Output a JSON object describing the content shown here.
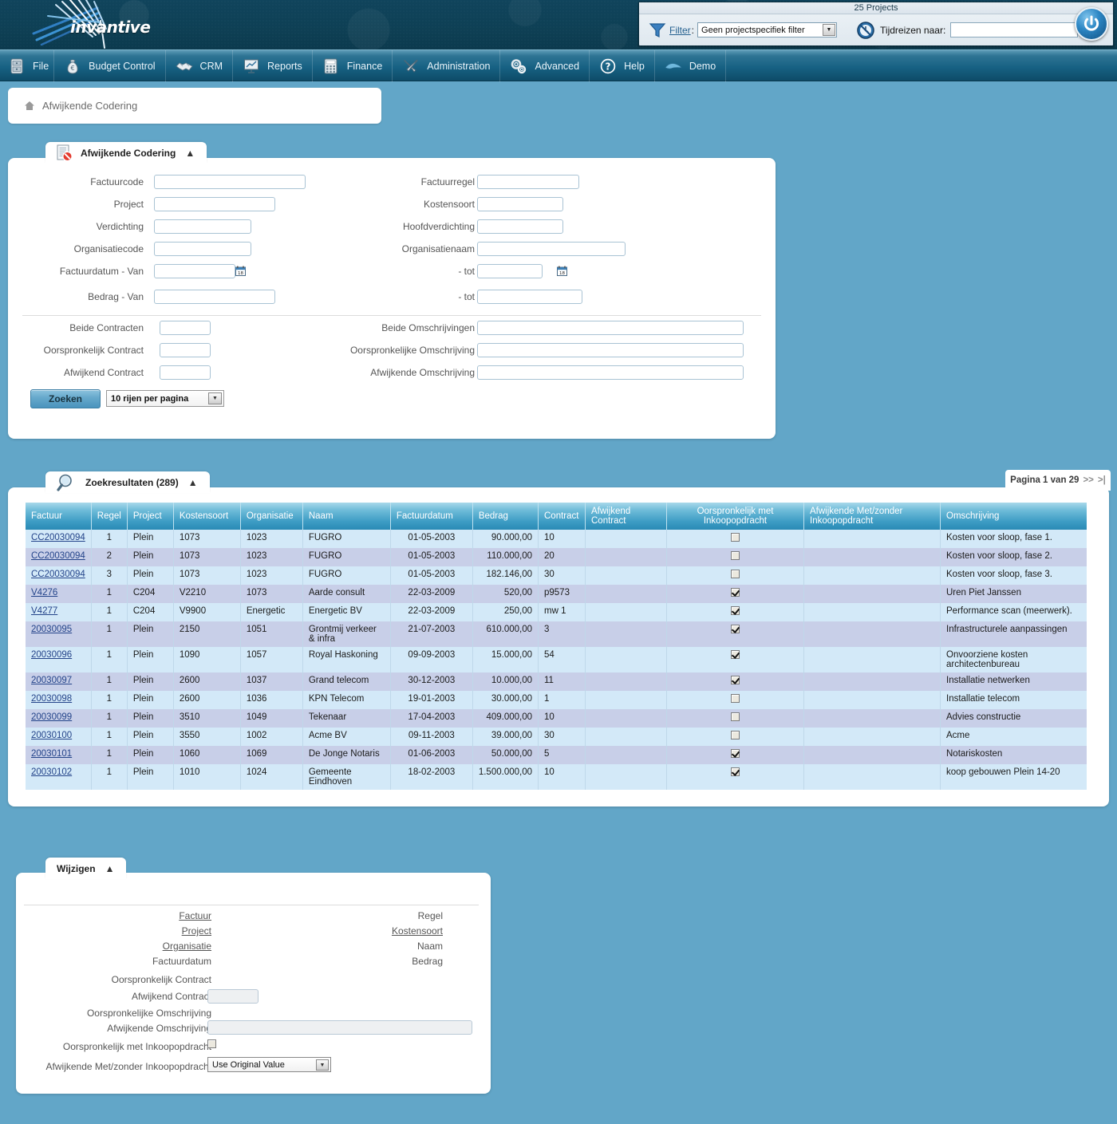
{
  "banner": {
    "logo_text": "invantive",
    "projects_count_label": "25 Projects",
    "filter_label": "Filter",
    "filter_colon": ":",
    "filter_value": "Geen projectspecifiek filter",
    "timetravel_label": "Tijdreizen naar:",
    "timetravel_value": ""
  },
  "menu": {
    "items": [
      {
        "label": "File",
        "icon": "file-cabinet-icon"
      },
      {
        "label": "Budget Control",
        "icon": "money-bag-icon"
      },
      {
        "label": "CRM",
        "icon": "handshake-icon"
      },
      {
        "label": "Reports",
        "icon": "presentation-chart-icon"
      },
      {
        "label": "Finance",
        "icon": "calculator-icon"
      },
      {
        "label": "Administration",
        "icon": "tools-icon"
      },
      {
        "label": "Advanced",
        "icon": "gears-icon"
      },
      {
        "label": "Help",
        "icon": "question-circle-icon"
      },
      {
        "label": "Demo",
        "icon": "bird-logo-icon"
      }
    ]
  },
  "breadcrumb": {
    "home_icon": "home-icon",
    "text": "Afwijkende Codering"
  },
  "search_panel": {
    "tab_label": "Afwijkende Codering",
    "tab_icon": "document-blocked-icon",
    "collapse_icon": "chevron-up-icon",
    "fields_left": [
      {
        "label": "Factuurcode",
        "value": ""
      },
      {
        "label": "Project",
        "value": ""
      },
      {
        "label": "Verdichting",
        "value": ""
      },
      {
        "label": "Organisatiecode",
        "value": ""
      },
      {
        "label": "Factuurdatum - Van",
        "value": ""
      },
      {
        "label": "Bedrag - Van",
        "value": ""
      }
    ],
    "fields_right": [
      {
        "label": "Factuurregel",
        "value": ""
      },
      {
        "label": "Kostensoort",
        "value": ""
      },
      {
        "label": "Hoofdverdichting",
        "value": ""
      },
      {
        "label": "Organisatienaam",
        "value": ""
      },
      {
        "label": "- tot",
        "value": ""
      },
      {
        "label": "- tot",
        "value": ""
      }
    ],
    "fields_left2": [
      {
        "label": "Beide Contracten",
        "value": ""
      },
      {
        "label": "Oorspronkelijk Contract",
        "value": ""
      },
      {
        "label": "Afwijkend Contract",
        "value": ""
      }
    ],
    "fields_right2": [
      {
        "label": "Beide Omschrijvingen",
        "value": ""
      },
      {
        "label": "Oorspronkelijke Omschrijving",
        "value": ""
      },
      {
        "label": "Afwijkende Omschrijving",
        "value": ""
      }
    ],
    "search_button": "Zoeken",
    "rows_per_page": "10 rijen per pagina"
  },
  "results": {
    "tab_label": "Zoekresultaten (289)",
    "tab_icon": "magnifier-icon",
    "collapse_icon": "chevron-up-icon",
    "pager_text": "Pagina 1 van 29",
    "pager_next": ">>",
    "pager_last": ">|",
    "columns": [
      "Factuur",
      "Regel",
      "Project",
      "Kostensoort",
      "Organisatie",
      "Naam",
      "Factuurdatum",
      "Bedrag",
      "Contract",
      "Afwijkend Contract",
      "Oorspronkelijk met Inkoopopdracht",
      "Afwijkende Met/zonder Inkoopopdracht",
      "Omschrijving"
    ],
    "rows": [
      {
        "factuur": "CC20030094",
        "regel": "1",
        "project": "Plein",
        "kostensoort": "1073",
        "organisatie": "1023",
        "naam": "FUGRO",
        "factuurdatum": "01-05-2003",
        "bedrag": "90.000,00",
        "contract": "10",
        "afwijkend_contract": "",
        "oorspronkelijk_inkoop": false,
        "afwijkende_inkoop": "",
        "omschrijving": "Kosten voor sloop, fase 1."
      },
      {
        "factuur": "CC20030094",
        "regel": "2",
        "project": "Plein",
        "kostensoort": "1073",
        "organisatie": "1023",
        "naam": "FUGRO",
        "factuurdatum": "01-05-2003",
        "bedrag": "110.000,00",
        "contract": "20",
        "afwijkend_contract": "",
        "oorspronkelijk_inkoop": false,
        "afwijkende_inkoop": "",
        "omschrijving": "Kosten voor sloop, fase 2."
      },
      {
        "factuur": "CC20030094",
        "regel": "3",
        "project": "Plein",
        "kostensoort": "1073",
        "organisatie": "1023",
        "naam": "FUGRO",
        "factuurdatum": "01-05-2003",
        "bedrag": "182.146,00",
        "contract": "30",
        "afwijkend_contract": "",
        "oorspronkelijk_inkoop": false,
        "afwijkende_inkoop": "",
        "omschrijving": "Kosten voor sloop, fase 3."
      },
      {
        "factuur": "V4276",
        "regel": "1",
        "project": "C204",
        "kostensoort": "V2210",
        "organisatie": "1073",
        "naam": "Aarde consult",
        "factuurdatum": "22-03-2009",
        "bedrag": "520,00",
        "contract": "p9573",
        "afwijkend_contract": "",
        "oorspronkelijk_inkoop": true,
        "afwijkende_inkoop": "",
        "omschrijving": "Uren Piet Janssen"
      },
      {
        "factuur": "V4277",
        "regel": "1",
        "project": "C204",
        "kostensoort": "V9900",
        "organisatie": "Energetic",
        "naam": "Energetic BV",
        "factuurdatum": "22-03-2009",
        "bedrag": "250,00",
        "contract": "mw 1",
        "afwijkend_contract": "",
        "oorspronkelijk_inkoop": true,
        "afwijkende_inkoop": "",
        "omschrijving": "Performance scan (meerwerk)."
      },
      {
        "factuur": "20030095",
        "regel": "1",
        "project": "Plein",
        "kostensoort": "2150",
        "organisatie": "1051",
        "naam": "Grontmij verkeer & infra",
        "factuurdatum": "21-07-2003",
        "bedrag": "610.000,00",
        "contract": "3",
        "afwijkend_contract": "",
        "oorspronkelijk_inkoop": true,
        "afwijkende_inkoop": "",
        "omschrijving": "Infrastructurele aanpassingen"
      },
      {
        "factuur": "20030096",
        "regel": "1",
        "project": "Plein",
        "kostensoort": "1090",
        "organisatie": "1057",
        "naam": "Royal Haskoning",
        "factuurdatum": "09-09-2003",
        "bedrag": "15.000,00",
        "contract": "54",
        "afwijkend_contract": "",
        "oorspronkelijk_inkoop": true,
        "afwijkende_inkoop": "",
        "omschrijving": "Onvoorziene kosten architectenbureau"
      },
      {
        "factuur": "20030097",
        "regel": "1",
        "project": "Plein",
        "kostensoort": "2600",
        "organisatie": "1037",
        "naam": "Grand telecom",
        "factuurdatum": "30-12-2003",
        "bedrag": "10.000,00",
        "contract": "11",
        "afwijkend_contract": "",
        "oorspronkelijk_inkoop": true,
        "afwijkende_inkoop": "",
        "omschrijving": "Installatie netwerken"
      },
      {
        "factuur": "20030098",
        "regel": "1",
        "project": "Plein",
        "kostensoort": "2600",
        "organisatie": "1036",
        "naam": "KPN Telecom",
        "factuurdatum": "19-01-2003",
        "bedrag": "30.000,00",
        "contract": "1",
        "afwijkend_contract": "",
        "oorspronkelijk_inkoop": false,
        "afwijkende_inkoop": "",
        "omschrijving": "Installatie telecom"
      },
      {
        "factuur": "20030099",
        "regel": "1",
        "project": "Plein",
        "kostensoort": "3510",
        "organisatie": "1049",
        "naam": "Tekenaar",
        "factuurdatum": "17-04-2003",
        "bedrag": "409.000,00",
        "contract": "10",
        "afwijkend_contract": "",
        "oorspronkelijk_inkoop": false,
        "afwijkende_inkoop": "",
        "omschrijving": "Advies constructie"
      },
      {
        "factuur": "20030100",
        "regel": "1",
        "project": "Plein",
        "kostensoort": "3550",
        "organisatie": "1002",
        "naam": "Acme BV",
        "factuurdatum": "09-11-2003",
        "bedrag": "39.000,00",
        "contract": "30",
        "afwijkend_contract": "",
        "oorspronkelijk_inkoop": false,
        "afwijkende_inkoop": "",
        "omschrijving": "Acme"
      },
      {
        "factuur": "20030101",
        "regel": "1",
        "project": "Plein",
        "kostensoort": "1060",
        "organisatie": "1069",
        "naam": "De Jonge Notaris",
        "factuurdatum": "01-06-2003",
        "bedrag": "50.000,00",
        "contract": "5",
        "afwijkend_contract": "",
        "oorspronkelijk_inkoop": true,
        "afwijkende_inkoop": "",
        "omschrijving": "Notariskosten"
      },
      {
        "factuur": "20030102",
        "regel": "1",
        "project": "Plein",
        "kostensoort": "1010",
        "organisatie": "1024",
        "naam": "Gemeente Eindhoven",
        "factuurdatum": "18-02-2003",
        "bedrag": "1.500.000,00",
        "contract": "10",
        "afwijkend_contract": "",
        "oorspronkelijk_inkoop": true,
        "afwijkende_inkoop": "",
        "omschrijving": "koop gebouwen Plein 14-20"
      }
    ]
  },
  "edit_panel": {
    "tab_label": "Wijzigen",
    "collapse_icon": "chevron-up-icon",
    "labels_left": [
      {
        "label": "Factuur",
        "link": true
      },
      {
        "label": "Project",
        "link": true
      },
      {
        "label": "Organisatie",
        "link": true
      },
      {
        "label": "Factuurdatum",
        "link": false
      }
    ],
    "labels_right": [
      {
        "label": "Regel",
        "link": false
      },
      {
        "label": "Kostensoort",
        "link": true
      },
      {
        "label": "Naam",
        "link": false
      },
      {
        "label": "Bedrag",
        "link": false
      }
    ],
    "fields": [
      {
        "label": "Oorspronkelijk Contract",
        "type": "text",
        "value": ""
      },
      {
        "label": "Afwijkend Contract",
        "type": "input",
        "value": ""
      },
      {
        "label": "Oorspronkelijke Omschrijving",
        "type": "text",
        "value": ""
      },
      {
        "label": "Afwijkende Omschrijving",
        "type": "input-wide",
        "value": ""
      },
      {
        "label": "Oorspronkelijk met Inkoopopdracht",
        "type": "checkbox",
        "value": ""
      },
      {
        "label": "Afwijkende Met/zonder Inkoopopdracht",
        "type": "select",
        "value": "Use Original Value"
      }
    ],
    "select_value": "Use Original Value"
  },
  "colors": {
    "page_bg": "#62a6c8",
    "banner_dark": "#0e4055",
    "menu_blue": "#176183",
    "header_blue": "#3d9cc4",
    "row_odd": "#d3e9f8",
    "row_even": "#c8cfe8",
    "link": "#24448a"
  }
}
